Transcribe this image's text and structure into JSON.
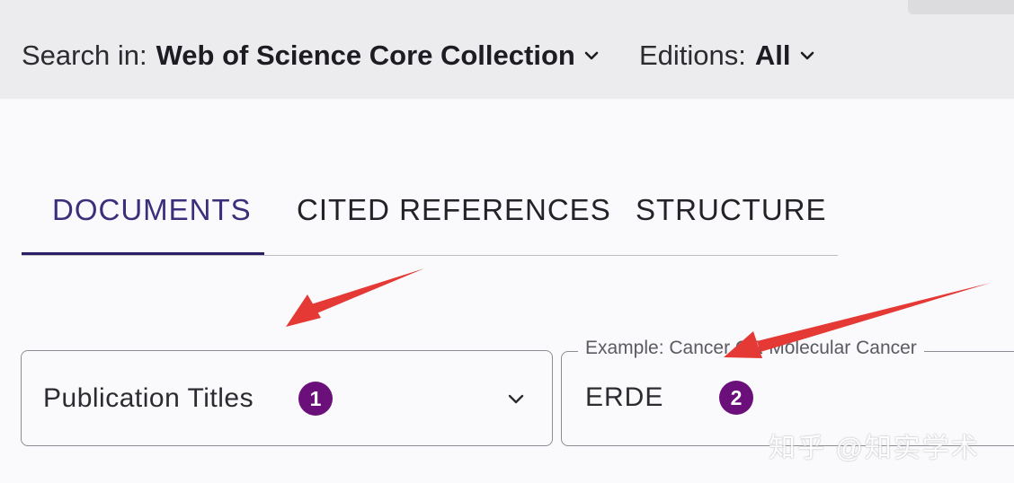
{
  "search_bar": {
    "search_in_label": "Search in:",
    "collection_value": "Web of Science Core Collection",
    "editions_label": "Editions:",
    "editions_value": "All"
  },
  "tabs": [
    {
      "label": "DOCUMENTS",
      "active": true
    },
    {
      "label": "CITED REFERENCES",
      "active": false
    },
    {
      "label": "STRUCTURE",
      "active": false
    }
  ],
  "search_row": {
    "field_type_value": "Publication Titles",
    "field_type_badge": "1",
    "query_placeholder": "Example: Cancer OR Molecular Cancer",
    "query_value": "ERDE",
    "query_badge": "2"
  },
  "watermark": "知乎 @知实学术",
  "colors": {
    "accent_tab": "#2a1f66",
    "badge": "#6b0f7a",
    "annotation_arrow": "#e53935"
  },
  "icons": [
    "chevron-down-icon",
    "annotation-arrow"
  ]
}
